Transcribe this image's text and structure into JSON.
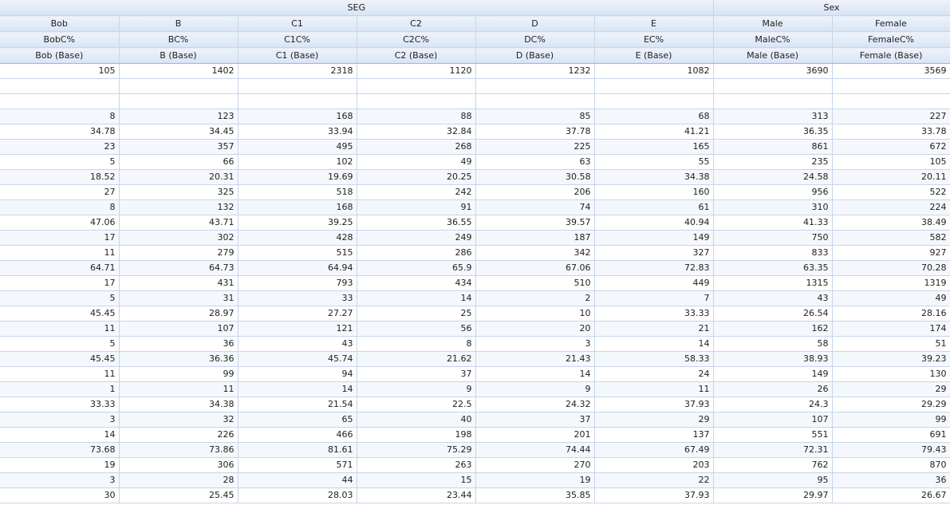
{
  "groups": [
    {
      "label": "SEG",
      "span": 6
    },
    {
      "label": "Sex",
      "span": 2
    }
  ],
  "header_rows": [
    [
      "Bob",
      "B",
      "C1",
      "C2",
      "D",
      "E",
      "Male",
      "Female"
    ],
    [
      "BobC%",
      "BC%",
      "C1C%",
      "C2C%",
      "DC%",
      "EC%",
      "MaleC%",
      "FemaleC%"
    ],
    [
      "Bob (Base)",
      "B (Base)",
      "C1 (Base)",
      "C2 (Base)",
      "D (Base)",
      "E (Base)",
      "Male (Base)",
      "Female (Base)"
    ]
  ],
  "rows": [
    [
      "105",
      "1402",
      "2318",
      "1120",
      "1232",
      "1082",
      "3690",
      "3569"
    ],
    [
      "",
      "",
      "",
      "",
      "",
      "",
      "",
      ""
    ],
    [
      "",
      "",
      "",
      "",
      "",
      "",
      "",
      ""
    ],
    [
      "8",
      "123",
      "168",
      "88",
      "85",
      "68",
      "313",
      "227"
    ],
    [
      "34.78",
      "34.45",
      "33.94",
      "32.84",
      "37.78",
      "41.21",
      "36.35",
      "33.78"
    ],
    [
      "23",
      "357",
      "495",
      "268",
      "225",
      "165",
      "861",
      "672"
    ],
    [
      "5",
      "66",
      "102",
      "49",
      "63",
      "55",
      "235",
      "105"
    ],
    [
      "18.52",
      "20.31",
      "19.69",
      "20.25",
      "30.58",
      "34.38",
      "24.58",
      "20.11"
    ],
    [
      "27",
      "325",
      "518",
      "242",
      "206",
      "160",
      "956",
      "522"
    ],
    [
      "8",
      "132",
      "168",
      "91",
      "74",
      "61",
      "310",
      "224"
    ],
    [
      "47.06",
      "43.71",
      "39.25",
      "36.55",
      "39.57",
      "40.94",
      "41.33",
      "38.49"
    ],
    [
      "17",
      "302",
      "428",
      "249",
      "187",
      "149",
      "750",
      "582"
    ],
    [
      "11",
      "279",
      "515",
      "286",
      "342",
      "327",
      "833",
      "927"
    ],
    [
      "64.71",
      "64.73",
      "64.94",
      "65.9",
      "67.06",
      "72.83",
      "63.35",
      "70.28"
    ],
    [
      "17",
      "431",
      "793",
      "434",
      "510",
      "449",
      "1315",
      "1319"
    ],
    [
      "5",
      "31",
      "33",
      "14",
      "2",
      "7",
      "43",
      "49"
    ],
    [
      "45.45",
      "28.97",
      "27.27",
      "25",
      "10",
      "33.33",
      "26.54",
      "28.16"
    ],
    [
      "11",
      "107",
      "121",
      "56",
      "20",
      "21",
      "162",
      "174"
    ],
    [
      "5",
      "36",
      "43",
      "8",
      "3",
      "14",
      "58",
      "51"
    ],
    [
      "45.45",
      "36.36",
      "45.74",
      "21.62",
      "21.43",
      "58.33",
      "38.93",
      "39.23"
    ],
    [
      "11",
      "99",
      "94",
      "37",
      "14",
      "24",
      "149",
      "130"
    ],
    [
      "1",
      "11",
      "14",
      "9",
      "9",
      "11",
      "26",
      "29"
    ],
    [
      "33.33",
      "34.38",
      "21.54",
      "22.5",
      "24.32",
      "37.93",
      "24.3",
      "29.29"
    ],
    [
      "3",
      "32",
      "65",
      "40",
      "37",
      "29",
      "107",
      "99"
    ],
    [
      "14",
      "226",
      "466",
      "198",
      "201",
      "137",
      "551",
      "691"
    ],
    [
      "73.68",
      "73.86",
      "81.61",
      "75.29",
      "74.44",
      "67.49",
      "72.31",
      "79.43"
    ],
    [
      "19",
      "306",
      "571",
      "263",
      "270",
      "203",
      "762",
      "870"
    ],
    [
      "3",
      "28",
      "44",
      "15",
      "19",
      "22",
      "95",
      "36"
    ],
    [
      "30",
      "25.45",
      "28.03",
      "23.44",
      "35.85",
      "37.93",
      "29.97",
      "26.67"
    ]
  ]
}
